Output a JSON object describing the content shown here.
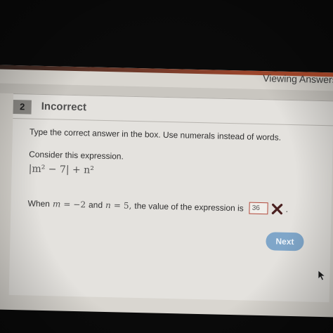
{
  "header": {
    "viewing_label": "Viewing Answers"
  },
  "question": {
    "number": "2",
    "status": "Incorrect",
    "instruction": "Type the correct answer in the box. Use numerals instead of words.",
    "consider": "Consider this expression.",
    "expression": "|m² − 7| + n²",
    "prompt": {
      "when": "When",
      "m_var": "m",
      "equals_1": "=",
      "m_value": "−2",
      "and": "and",
      "n_var": "n",
      "equals_2": "=",
      "n_value": "5,",
      "suffix": "the value of the expression is",
      "period": "."
    },
    "answer_value": "36",
    "result_icon": "x-icon",
    "result_color": "#4a2020"
  },
  "actions": {
    "next_label": "Next"
  },
  "colors": {
    "accent": "#c2512e",
    "button": "#7fa6c9",
    "error_border": "#b24a3c"
  }
}
